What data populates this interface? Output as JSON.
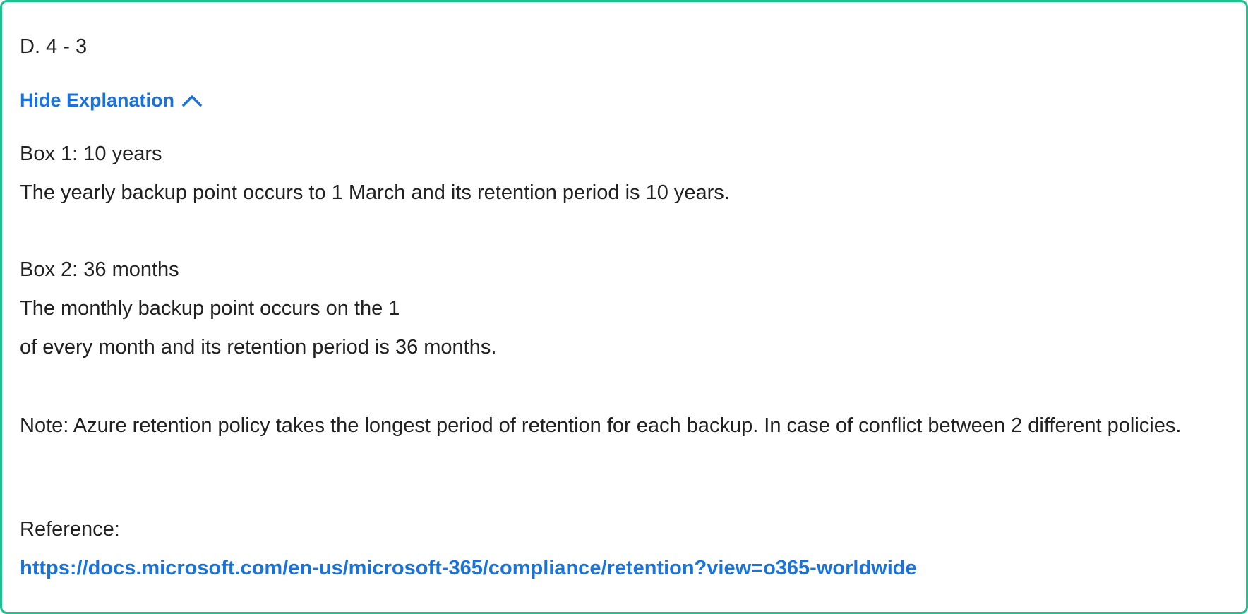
{
  "answer": {
    "option": "D. 4 - 3"
  },
  "explanation_toggle": {
    "label": "Hide Explanation",
    "icon": "chevron-up-icon",
    "color": "#1a73d9"
  },
  "explanation": {
    "box1_title": "Box 1: 10 years",
    "box1_text": "The yearly backup point occurs to 1 March and its retention period is 10 years.",
    "box2_title": "Box 2: 36 months",
    "box2_text_line1": "The monthly backup point occurs on the 1",
    "box2_text_line2": "of every month and its retention period is 36 months.",
    "note": "Note: Azure retention policy takes the longest period of retention for each backup. In case of conflict between 2 different policies.",
    "reference_label": "Reference:",
    "reference_url": "https://docs.microsoft.com/en-us/microsoft-365/compliance/retention?view=o365-worldwide"
  },
  "colors": {
    "border": "#1fbf8f",
    "link": "#1a73d9",
    "text": "#212121"
  }
}
